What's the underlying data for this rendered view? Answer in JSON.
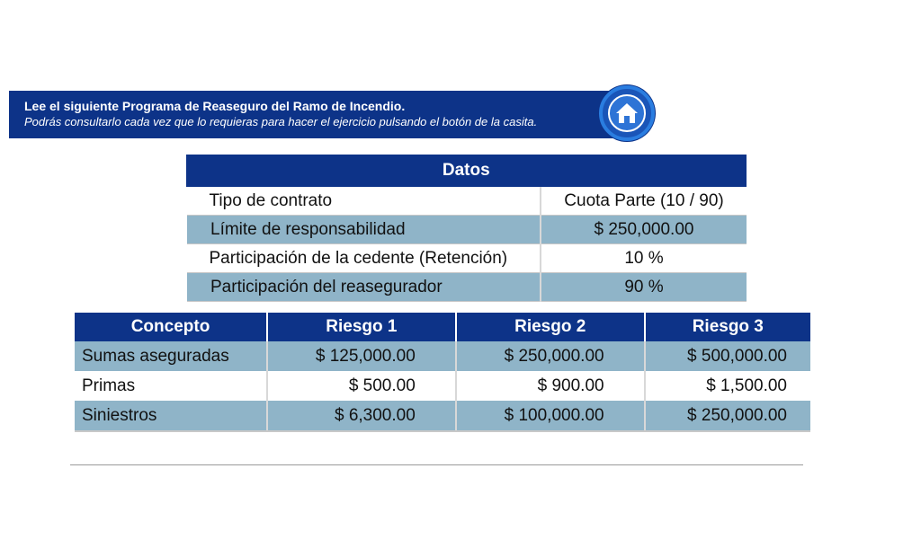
{
  "banner": {
    "title": "Lee el siguiente Programa de Reaseguro del Ramo de Incendio.",
    "subtitle": "Podrás consultarlo cada vez que lo requieras para hacer el ejercicio pulsando el botón de la casita."
  },
  "home_button": {
    "icon": "home-icon"
  },
  "datos": {
    "header": "Datos",
    "rows": [
      {
        "label": "Tipo de contrato",
        "value": "Cuota Parte (10 / 90)"
      },
      {
        "label": "Límite de responsabilidad",
        "value": "$ 250,000.00"
      },
      {
        "label": "Participación de la cedente (Retención)",
        "value": "10 %"
      },
      {
        "label": "Participación del reasegurador",
        "value": "90 %"
      }
    ]
  },
  "conceptos": {
    "headers": [
      "Concepto",
      "Riesgo 1",
      "Riesgo 2",
      "Riesgo 3"
    ],
    "rows": [
      [
        "Sumas aseguradas",
        "$ 125,000.00",
        "$ 250,000.00",
        "$ 500,000.00"
      ],
      [
        "Primas",
        "$ 500.00",
        "$ 900.00",
        "$ 1,500.00"
      ],
      [
        "Siniestros",
        "$ 6,300.00",
        "$ 100,000.00",
        "$ 250,000.00"
      ]
    ]
  },
  "colors": {
    "header_blue": "#0d3388",
    "row_shade": "#8fb4c8",
    "button_blue": "#1a55b8"
  }
}
